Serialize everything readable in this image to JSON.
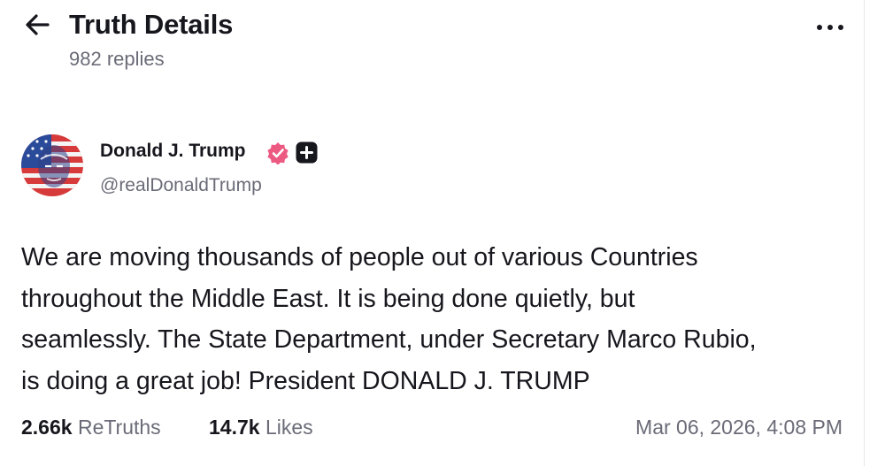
{
  "header": {
    "back_icon": "arrow-left-icon",
    "title": "Truth Details",
    "replies": "982 replies",
    "more_icon": "more-horizontal-icon"
  },
  "post": {
    "author": {
      "name": "Donald J. Trump",
      "handle": "@realDonaldTrump",
      "verified_icon": "verified-badge-icon",
      "verified_color": "#ec5a82",
      "plus_icon": "plus-badge-icon"
    },
    "body": "We are moving thousands of people out of various Countries\nthroughout the Middle East. It is being done quietly, but\nseamlessly. The State Department, under Secretary Marco Rubio,\nis doing a great job! President DONALD J. TRUMP",
    "stats": {
      "retruths_count": "2.66k",
      "retruths_label": "ReTruths",
      "likes_count": "14.7k",
      "likes_label": "Likes"
    },
    "timestamp": "Mar 06, 2026, 4:08 PM"
  },
  "colors": {
    "text": "#16161d",
    "muted": "#6b6b78",
    "verified": "#ec5a82"
  }
}
